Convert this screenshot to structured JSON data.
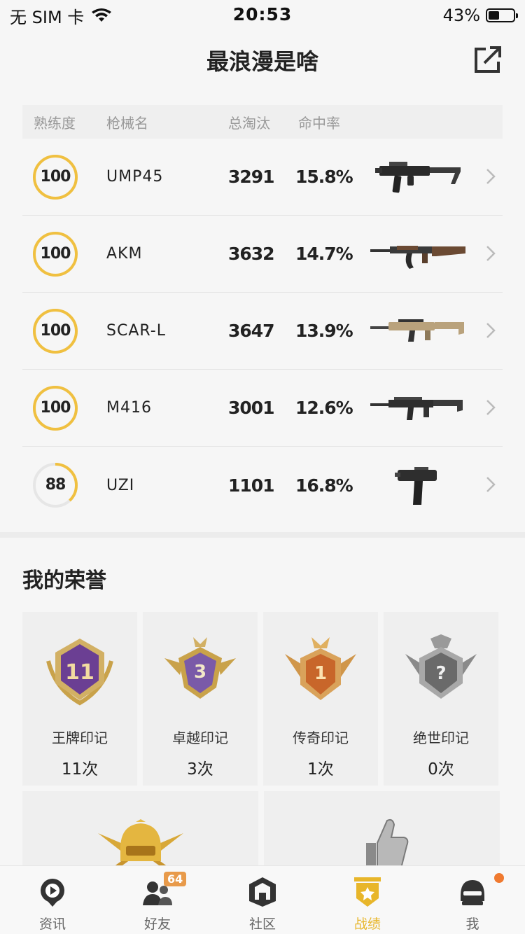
{
  "status_bar": {
    "carrier": "无 SIM 卡",
    "time": "20:53",
    "battery": "43%",
    "battery_level": 0.43
  },
  "header": {
    "title": "最浪漫是啥"
  },
  "weapon_table": {
    "columns": [
      "熟练度",
      "枪械名",
      "总淘汰",
      "命中率"
    ],
    "rows": [
      {
        "mastery": "100",
        "mastery_level": 1.0,
        "name": "UMP45",
        "kills": "3291",
        "hit_rate": "15.8%",
        "gun_icon": "smg-icon"
      },
      {
        "mastery": "100",
        "mastery_level": 1.0,
        "name": "AKM",
        "kills": "3632",
        "hit_rate": "14.7%",
        "gun_icon": "rifle-icon"
      },
      {
        "mastery": "100",
        "mastery_level": 1.0,
        "name": "SCAR-L",
        "kills": "3647",
        "hit_rate": "13.9%",
        "gun_icon": "rifle-icon"
      },
      {
        "mastery": "100",
        "mastery_level": 1.0,
        "name": "M416",
        "kills": "3001",
        "hit_rate": "12.6%",
        "gun_icon": "rifle-icon"
      },
      {
        "mastery": "88",
        "mastery_level": 0.38,
        "name": "UZI",
        "kills": "1101",
        "hit_rate": "16.8%",
        "gun_icon": "pistol-smg-icon"
      }
    ]
  },
  "honors": {
    "title": "我的荣誉",
    "badges": [
      {
        "label": "王牌印记",
        "count": "11次",
        "emblem_text": "11",
        "color": "#6b3f93"
      },
      {
        "label": "卓越印记",
        "count": "3次",
        "emblem_text": "3",
        "color": "#7a5aa8"
      },
      {
        "label": "传奇印记",
        "count": "1次",
        "emblem_text": "1",
        "color": "#c8662a"
      },
      {
        "label": "绝世印记",
        "count": "0次",
        "emblem_text": "?",
        "color": "#6a6a6a"
      }
    ]
  },
  "tab_bar": {
    "tabs": [
      {
        "label": "资讯",
        "icon": "news-play-icon"
      },
      {
        "label": "好友",
        "icon": "friends-icon",
        "badge": "64"
      },
      {
        "label": "社区",
        "icon": "community-icon"
      },
      {
        "label": "战绩",
        "icon": "record-shield-icon",
        "active": true
      },
      {
        "label": "我",
        "icon": "profile-helmet-icon"
      }
    ]
  },
  "colors": {
    "accent": "#e8b62a",
    "ring": "#f0c040",
    "ring_track": "#e6e6e6"
  }
}
